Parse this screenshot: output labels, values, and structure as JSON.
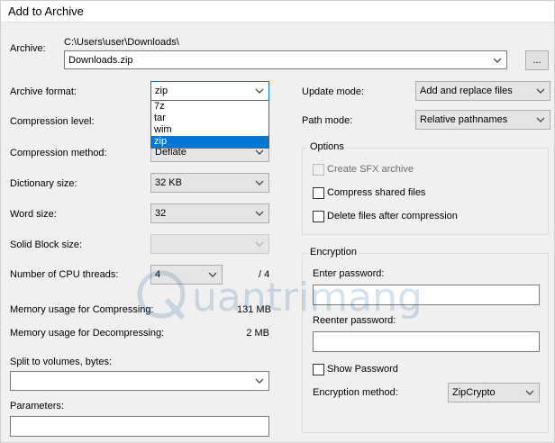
{
  "window": {
    "title": "Add to Archive"
  },
  "archive": {
    "label": "Archive:",
    "path": "C:\\Users\\user\\Downloads\\",
    "filename": "Downloads.zip",
    "browse_label": "..."
  },
  "left": {
    "archive_format": {
      "label": "Archive format:",
      "value": "zip",
      "options": [
        "7z",
        "tar",
        "wim",
        "zip"
      ]
    },
    "compression_level": {
      "label": "Compression level:"
    },
    "compression_method": {
      "label": "Compression method:",
      "value": "Deflate"
    },
    "dictionary_size": {
      "label": "Dictionary size:",
      "value": "32 KB"
    },
    "word_size": {
      "label": "Word size:",
      "value": "32"
    },
    "solid_block": {
      "label": "Solid Block size:",
      "value": ""
    },
    "cpu_threads": {
      "label": "Number of CPU threads:",
      "value": "4",
      "max": "/ 4"
    },
    "mem_compress": {
      "label": "Memory usage for Compressing:",
      "value": "131 MB"
    },
    "mem_decompress": {
      "label": "Memory usage for Decompressing:",
      "value": "2 MB"
    },
    "split": {
      "label": "Split to volumes, bytes:",
      "value": ""
    },
    "parameters": {
      "label": "Parameters:",
      "value": ""
    }
  },
  "right": {
    "update_mode": {
      "label": "Update mode:",
      "value": "Add and replace files"
    },
    "path_mode": {
      "label": "Path mode:",
      "value": "Relative pathnames"
    },
    "options": {
      "title": "Options",
      "create_sfx": {
        "label": "Create SFX archive",
        "checked": false,
        "enabled": false
      },
      "compress_shared": {
        "label": "Compress shared files",
        "checked": false
      },
      "delete_after": {
        "label": "Delete files after compression",
        "checked": false
      }
    },
    "encryption": {
      "title": "Encryption",
      "enter_password_label": "Enter password:",
      "enter_password_value": "",
      "reenter_password_label": "Reenter password:",
      "reenter_password_value": "",
      "show_password": {
        "label": "Show Password",
        "checked": false
      },
      "method": {
        "label": "Encryption method:",
        "value": "ZipCrypto"
      }
    }
  },
  "watermark": {
    "text": "uantrimang",
    "icon": "q-logo"
  },
  "colors": {
    "accent": "#0078d7",
    "window_bg": "#f0f0f0"
  }
}
